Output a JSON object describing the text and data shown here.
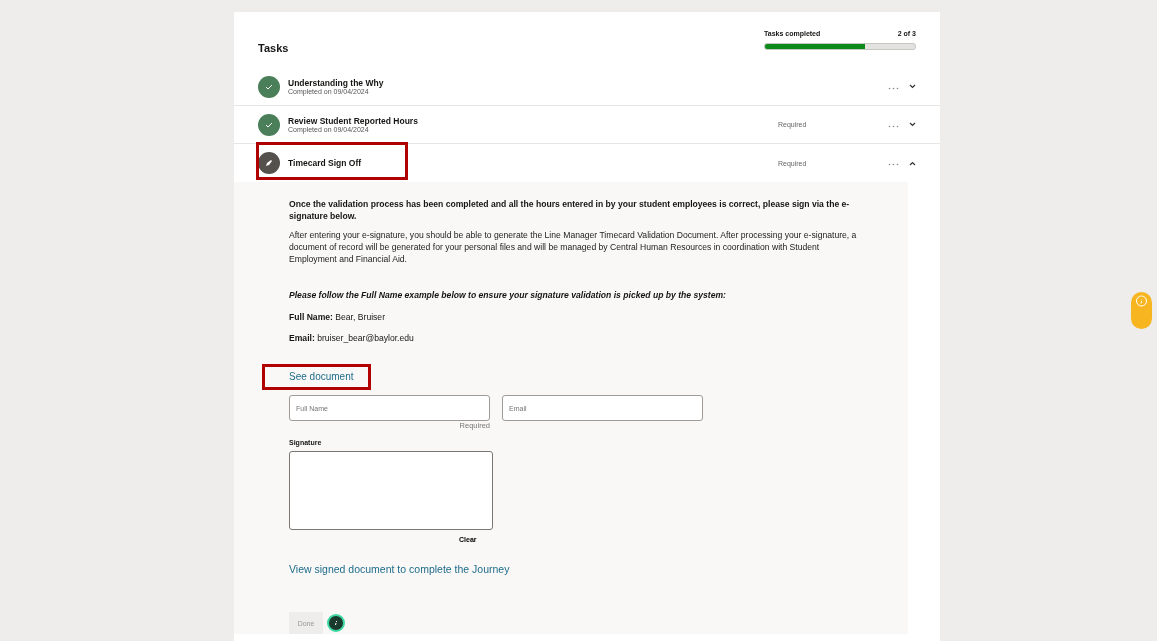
{
  "header": {
    "title": "Tasks",
    "progress_label": "Tasks completed",
    "progress_count": "2 of 3",
    "level": 0.667
  },
  "tasks": [
    {
      "title": "Understanding the Why",
      "subtitle": "Completed on 09/04/2024",
      "kind": "completed",
      "expanded": false,
      "highlighted": false
    },
    {
      "title": "Review Student Reported Hours",
      "subtitle": "Completed on 09/04/2024",
      "requirement": "Required",
      "kind": "completed",
      "expanded": false,
      "highlighted": false
    },
    {
      "title": "Timecard Sign Off",
      "requirement": "Required",
      "kind": "editing",
      "expanded": true,
      "highlighted": true
    }
  ],
  "detail": {
    "intro": "Once the validation process has been completed and all the hours entered in by your student employees is correct, please sign via the e-signature below.",
    "body": "After entering your e-signature, you should be able to generate the Line Manager Timecard Validation Document. After processing your e-signature, a document of record will be generated for your personal files and will be managed by Central Human Resources in coordination with Student Employment and Financial Aid.",
    "example_note": "Please follow the Full Name example below to ensure your signature validation is picked up by the system:",
    "examples": [
      {
        "label": "Full Name:",
        "value": "Bear, Bruiser"
      },
      {
        "label": "Email:",
        "value": "bruiser_bear@baylor.edu"
      }
    ],
    "see_document": {
      "label": "See document",
      "highlighted": true
    },
    "fields": [
      {
        "placeholder": "Full Name",
        "helper": "Required"
      },
      {
        "placeholder": "Email"
      }
    ],
    "signature_label": "Signature",
    "clear_label": "Clear",
    "view_link": "View signed document to complete the Journey",
    "done_button": {
      "label": "Done",
      "disabled": true
    }
  }
}
